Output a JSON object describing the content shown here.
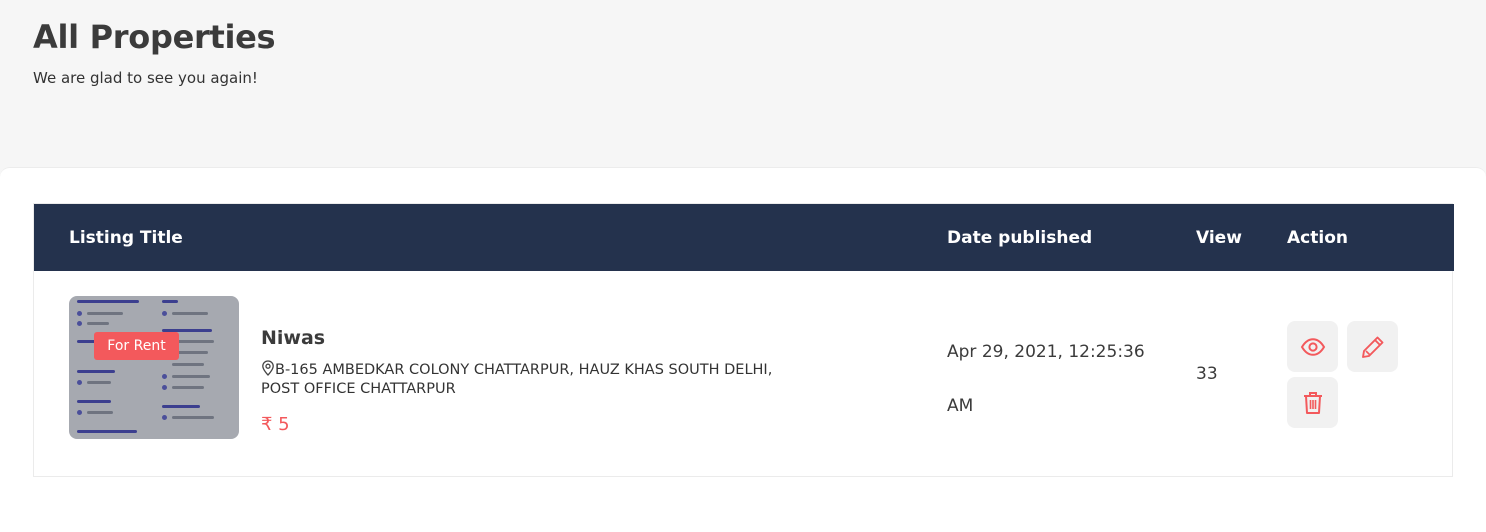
{
  "page": {
    "title": "All Properties",
    "subtitle": "We are glad to see you again!"
  },
  "table": {
    "headers": {
      "listing_title": "Listing Title",
      "date_published": "Date published",
      "view": "View",
      "action": "Action"
    },
    "rows": [
      {
        "badge": "For Rent",
        "title": "Niwas",
        "address": "B-165 Ambedkar Colony Chattarpur, Hauz Khas South Delhi, Post office Chattarpur",
        "price": "₹ 5",
        "date_line1": "Apr 29, 2021, 12:25:36",
        "date_line2": "AM",
        "views": "33"
      }
    ]
  },
  "colors": {
    "accent": "#f3595c",
    "header_bg": "#24324d",
    "page_bg": "#f6f6f6"
  },
  "icons": {
    "location": "map-pin-icon",
    "view": "eye-icon",
    "edit": "pencil-icon",
    "delete": "trash-icon"
  }
}
